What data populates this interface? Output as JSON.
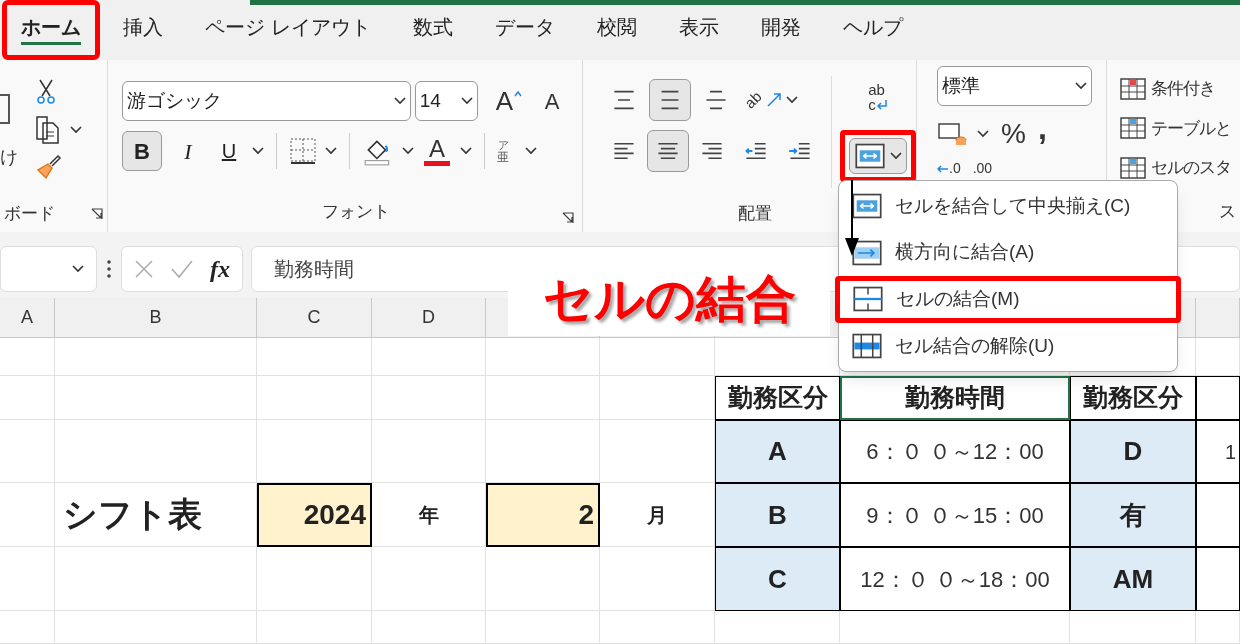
{
  "tabs": [
    {
      "label": "ホーム",
      "selected": true,
      "highlighted": true
    },
    {
      "label": "挿入",
      "selected": false,
      "highlighted": false
    },
    {
      "label": "ページ レイアウト",
      "selected": false,
      "highlighted": false
    },
    {
      "label": "数式",
      "selected": false,
      "highlighted": false
    },
    {
      "label": "データ",
      "selected": false,
      "highlighted": false
    },
    {
      "label": "校閲",
      "selected": false,
      "highlighted": false
    },
    {
      "label": "表示",
      "selected": false,
      "highlighted": false
    },
    {
      "label": "開発",
      "selected": false,
      "highlighted": false
    },
    {
      "label": "ヘルプ",
      "selected": false,
      "highlighted": false
    }
  ],
  "clipboard": {
    "paste_label": "け",
    "group_label": "ボード"
  },
  "font": {
    "font_name": "游ゴシック",
    "font_size": "14",
    "grow": "A",
    "shrink": "A",
    "bold": {
      "label": "B",
      "selected": true
    },
    "italic": {
      "label": "I",
      "selected": false
    },
    "underline": {
      "label": "U",
      "selected": false
    },
    "font_color": {
      "label": "A",
      "color": "#e81123"
    },
    "phonetic": {
      "top": "ア",
      "bottom": "亜"
    },
    "group_label": "フォント"
  },
  "alignment": {
    "vertical": [
      {
        "kind": "top",
        "selected": false
      },
      {
        "kind": "middle",
        "selected": true
      },
      {
        "kind": "bottom",
        "selected": false
      }
    ],
    "orientation": "ab",
    "horizontal": [
      {
        "kind": "left",
        "selected": false
      },
      {
        "kind": "center",
        "selected": true
      },
      {
        "kind": "right",
        "selected": false
      },
      {
        "kind": "outdent",
        "selected": false
      },
      {
        "kind": "indent",
        "selected": false
      }
    ],
    "wrap_text": {
      "top": "ab",
      "bottom": "c"
    },
    "merge_button": {
      "highlighted": true
    },
    "group_label": "配置"
  },
  "number": {
    "format": "標準",
    "percent": "%",
    "comma": ",",
    "decimals": [
      ".0",
      ".00"
    ]
  },
  "styles": {
    "items": [
      "条件付き",
      "テーブルと",
      "セルのスタ"
    ],
    "group_label": "ス"
  },
  "formula_bar": {
    "fx": "fx",
    "formula": "勤務時間"
  },
  "sheet": {
    "columns": [
      {
        "label": "A"
      },
      {
        "label": "B"
      },
      {
        "label": "C"
      },
      {
        "label": "D"
      },
      {},
      {},
      {},
      {},
      {},
      {}
    ],
    "rows": [
      {
        "cells": [
          {
            "kind": "blank",
            "selected": false
          },
          {
            "kind": "blank",
            "selected": false
          },
          {
            "kind": "blank",
            "selected": false
          },
          {
            "kind": "blank",
            "selected": false
          },
          {
            "kind": "blank",
            "selected": false
          },
          {
            "kind": "blank",
            "selected": false
          },
          {
            "kind": "blank",
            "selected": false
          },
          {
            "kind": "blank",
            "selected": false
          },
          {
            "kind": "blank",
            "selected": false
          },
          {
            "kind": "blank",
            "selected": false
          }
        ]
      },
      {
        "cells": [
          {
            "kind": "blank",
            "selected": false
          },
          {
            "kind": "blank",
            "selected": false
          },
          {
            "kind": "blank",
            "selected": false
          },
          {
            "kind": "blank",
            "selected": false
          },
          {
            "kind": "blank",
            "selected": false
          },
          {
            "kind": "blank",
            "selected": false
          },
          {
            "kind": "th",
            "text": "勤務区分",
            "selected": false
          },
          {
            "kind": "th",
            "text": "勤務時間",
            "selected": true
          },
          {
            "kind": "th",
            "text": "勤務区分",
            "selected": false
          },
          {
            "kind": "tblank",
            "selected": false
          }
        ]
      },
      {
        "cells": [
          {
            "kind": "blank",
            "selected": false
          },
          {
            "kind": "blank",
            "selected": false
          },
          {
            "kind": "blank",
            "selected": false
          },
          {
            "kind": "blank",
            "selected": false
          },
          {
            "kind": "blank",
            "selected": false
          },
          {
            "kind": "blank",
            "selected": false
          },
          {
            "kind": "key",
            "text": "A",
            "selected": false
          },
          {
            "kind": "time",
            "text": "6：０ ０～12：00",
            "selected": false
          },
          {
            "kind": "key",
            "text": "D",
            "selected": false
          },
          {
            "kind": "tcell",
            "text": "1",
            "selected": false
          }
        ]
      },
      {
        "cells": [
          {
            "kind": "blank",
            "selected": false
          },
          {
            "kind": "title",
            "text": "シフト表",
            "selected": false
          },
          {
            "kind": "input",
            "text": "2024",
            "selected": false
          },
          {
            "kind": "label",
            "text": "年",
            "selected": false
          },
          {
            "kind": "input",
            "text": "2",
            "selected": false
          },
          {
            "kind": "label",
            "text": "月",
            "selected": false
          },
          {
            "kind": "key",
            "text": "B",
            "selected": false
          },
          {
            "kind": "time",
            "text": "9：０ ０～15：00",
            "selected": false
          },
          {
            "kind": "key",
            "text": "有",
            "selected": false
          },
          {
            "kind": "tblank",
            "selected": false
          }
        ]
      },
      {
        "cells": [
          {
            "kind": "blank",
            "selected": false
          },
          {
            "kind": "blank",
            "selected": false
          },
          {
            "kind": "blank",
            "selected": false
          },
          {
            "kind": "blank",
            "selected": false
          },
          {
            "kind": "blank",
            "selected": false
          },
          {
            "kind": "blank",
            "selected": false
          },
          {
            "kind": "key",
            "text": "C",
            "selected": false
          },
          {
            "kind": "time",
            "text": "12：０ ０～18：00",
            "selected": false
          },
          {
            "kind": "key",
            "text": "AM",
            "selected": false
          },
          {
            "kind": "tblank",
            "selected": false
          }
        ]
      },
      {
        "cells": [
          {
            "kind": "blank",
            "selected": false
          },
          {
            "kind": "blank",
            "selected": false
          },
          {
            "kind": "blank",
            "selected": false
          },
          {
            "kind": "blank",
            "selected": false
          },
          {
            "kind": "blank",
            "selected": false
          },
          {
            "kind": "blank",
            "selected": false
          },
          {
            "kind": "blank",
            "selected": false
          },
          {
            "kind": "blank",
            "selected": false
          },
          {
            "kind": "blank",
            "selected": false
          },
          {
            "kind": "blank",
            "selected": false
          }
        ]
      }
    ]
  },
  "merge_menu": {
    "items": [
      {
        "kind": "merge-center",
        "label": "セルを結合して中央揃え(C)",
        "highlighted": false
      },
      {
        "kind": "merge-across",
        "label": "横方向に結合(A)",
        "highlighted": false
      },
      {
        "kind": "merge",
        "label": "セルの結合(M)",
        "highlighted": true
      },
      {
        "kind": "unmerge",
        "label": "セル結合の解除(U)",
        "highlighted": false
      }
    ]
  },
  "callout": {
    "label": "セルの結合"
  }
}
